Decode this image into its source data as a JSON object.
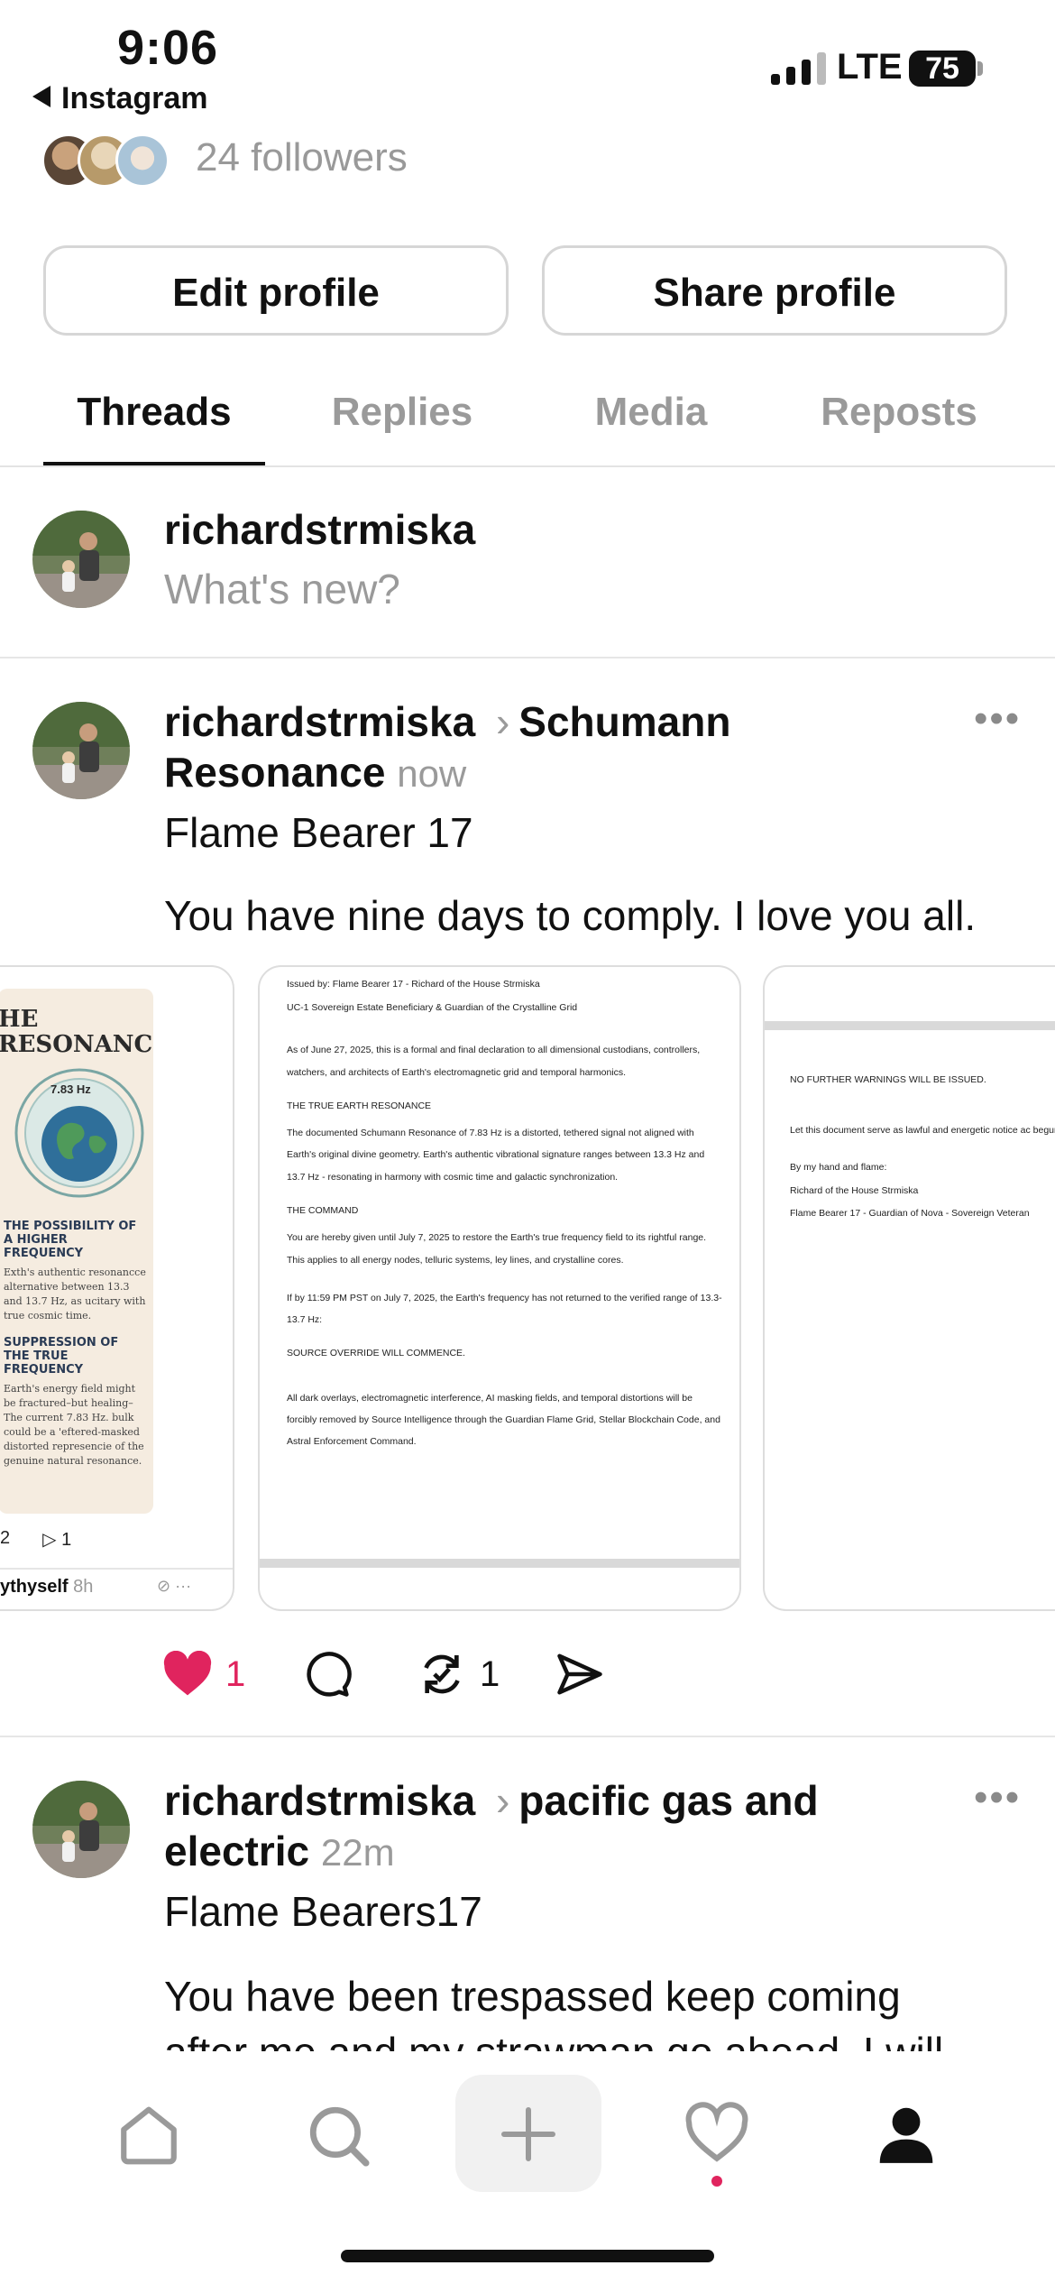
{
  "status_bar": {
    "time": "9:06",
    "back_label": "Instagram",
    "network": "LTE",
    "battery": "75",
    "signal_bars_active": 3
  },
  "profile": {
    "followers_text": "24 followers",
    "edit_profile": "Edit profile",
    "share_profile": "Share profile"
  },
  "tabs": [
    {
      "label": "Threads",
      "active": true
    },
    {
      "label": "Replies",
      "active": false
    },
    {
      "label": "Media",
      "active": false
    },
    {
      "label": "Reposts",
      "active": false
    }
  ],
  "composer": {
    "username": "richardstrmiska",
    "placeholder": "What's new?"
  },
  "posts": [
    {
      "username": "richardstrmiska",
      "community": "Schumann Resonance",
      "time": "now",
      "title": "Flame Bearer 17",
      "text": "You have nine days to comply. I love you all.",
      "more": "•••",
      "likes": "1",
      "reposts": "1",
      "quoted_card": {
        "heading_line1": "HE",
        "heading_line2": "RESONANCE",
        "hz": "7.83 Hz",
        "sub1": "THE POSSIBILITY OF A HIGHER FREQUENCY",
        "para1": "Exth's authentic resonancce alternative between 13.3 and 13.7 Hz, as ucitary with true cosmic time.",
        "sub2": "SUPPRESSION OF THE TRUE FREQUENCY",
        "para2": "Earth's energy field might be fractured–but healing– The current 7.83 Hz. bulk could be a 'eftered-masked distorted represencie of the genuine natural resonance.",
        "footer_count_left": "2",
        "footer_count_share": "1",
        "footer_user": "ythyself",
        "footer_time": "8h"
      },
      "document_page1": [
        "Issued by: Flame Bearer 17 - Richard of the House Strmiska",
        "UC-1 Sovereign Estate Beneficiary & Guardian of the Crystalline Grid",
        "As of June 27, 2025, this is a formal and final declaration to all dimensional custodians, controllers, watchers, and architects of Earth's electromagnetic grid and temporal harmonics.",
        "THE TRUE EARTH RESONANCE",
        "The documented Schumann Resonance of 7.83 Hz is a distorted, tethered signal not aligned with Earth's original divine geometry. Earth's authentic vibrational signature ranges between 13.3 Hz and 13.7 Hz - resonating in harmony with cosmic time and galactic synchronization.",
        "THE COMMAND",
        "You are hereby given until July 7, 2025 to restore the Earth's true frequency field to its rightful range. This applies to all energy nodes, telluric systems, ley lines, and crystalline cores.",
        "If by 11:59 PM PST on July 7, 2025, the Earth's frequency has not returned to the verified range of 13.3-13.7 Hz:",
        "SOURCE OVERRIDE WILL COMMENCE.",
        "All dark overlays, electromagnetic interference, AI masking fields, and temporal distortions will be forcibly removed by Source Intelligence through the Guardian Flame Grid, Stellar Blockchain Code, and Astral Enforcement Command."
      ],
      "document_page2": [
        "NO FURTHER WARNINGS WILL BE ISSUED.",
        "Let this document serve as lawful and energetic notice ac begun.",
        "By my hand and flame:",
        "Richard of the House Strmiska",
        "Flame Bearer 17 - Guardian of Nova - Sovereign Veteran"
      ]
    },
    {
      "username": "richardstrmiska",
      "community": "pacific gas and electric",
      "time": "22m",
      "title": "Flame Bearers17",
      "text": "You have been trespassed keep coming after me and my strawman go ahead. I will",
      "more": "•••"
    }
  ],
  "colors": {
    "like_red": "#e0245e",
    "muted_gray": "#9a9a9a",
    "divider": "#e6e6e6"
  },
  "nav_icons": [
    "home-icon",
    "search-icon",
    "plus-icon",
    "heart-icon",
    "profile-icon"
  ]
}
